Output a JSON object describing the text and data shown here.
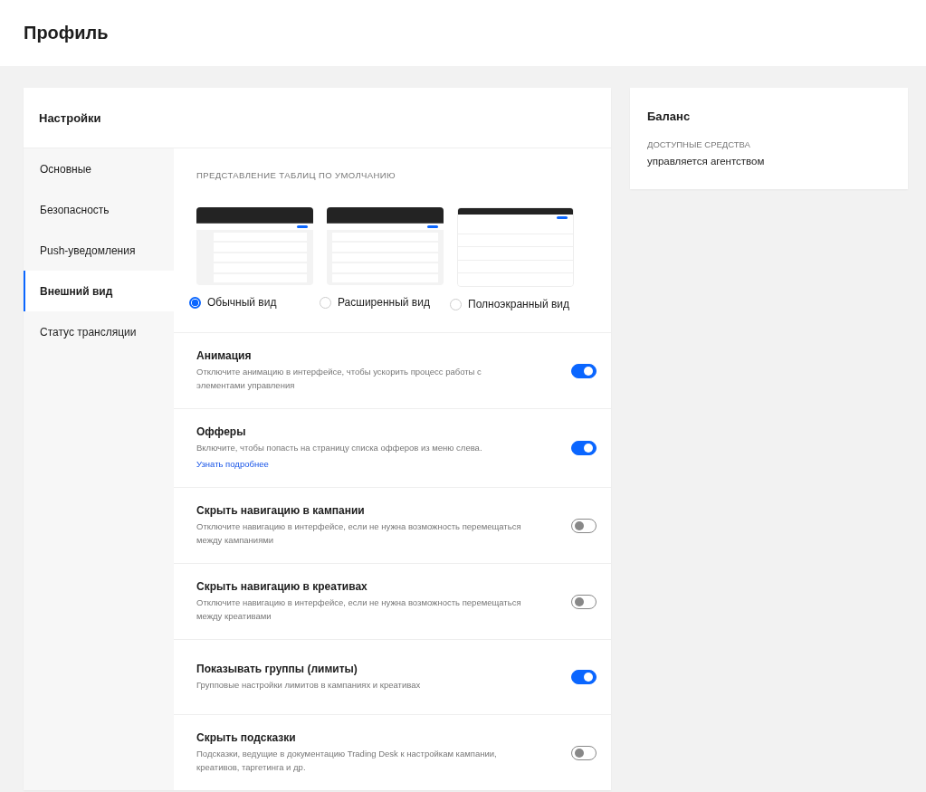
{
  "page_title": "Профиль",
  "settings": {
    "title": "Настройки",
    "menu": [
      {
        "label": "Основные",
        "selected": false
      },
      {
        "label": "Безопасность",
        "selected": false
      },
      {
        "label": "Push-уведомления",
        "selected": false
      },
      {
        "label": "Внешний вид",
        "selected": true
      },
      {
        "label": "Статус трансляции",
        "selected": false
      }
    ],
    "table_view": {
      "heading": "ПРЕДСТАВЛЕНИЕ ТАБЛИЦ ПО УМОЛЧАНИЮ",
      "options": [
        {
          "kind": "normal",
          "label": "Обычный вид",
          "selected": true
        },
        {
          "kind": "wide",
          "label": "Расширенный вид",
          "selected": false
        },
        {
          "kind": "full",
          "label": "Полноэкранный вид",
          "selected": false
        }
      ]
    },
    "toggles": [
      {
        "title": "Анимация",
        "description": "Отключите анимацию в интерфейсе, чтобы ускорить процесс работы с элементами управления",
        "on": true
      },
      {
        "title": "Офферы",
        "description": "Включите, чтобы попасть на страницу списка офферов из меню слева.",
        "link": "Узнать подробнее",
        "on": true
      },
      {
        "title": "Скрыть навигацию в кампании",
        "description": "Отключите навигацию в интерфейсе, если не нужна возможность перемещаться между кампаниями",
        "on": false
      },
      {
        "title": "Скрыть навигацию в креативах",
        "description": "Отключите навигацию в интерфейсе, если не нужна возможность перемещаться между креативами",
        "on": false
      },
      {
        "title": "Показывать группы (лимиты)",
        "description": "Групповые настройки лимитов в кампаниях и креативах",
        "on": true
      },
      {
        "title": "Скрыть подсказки",
        "description": "Подсказки, ведущие в документацию Trading Desk к настройкам кампании, креативов, таргетинга и др.",
        "on": false
      }
    ]
  },
  "balance": {
    "title": "Баланс",
    "label": "ДОСТУПНЫЕ СРЕДСТВА",
    "value": "управляется агентством"
  }
}
